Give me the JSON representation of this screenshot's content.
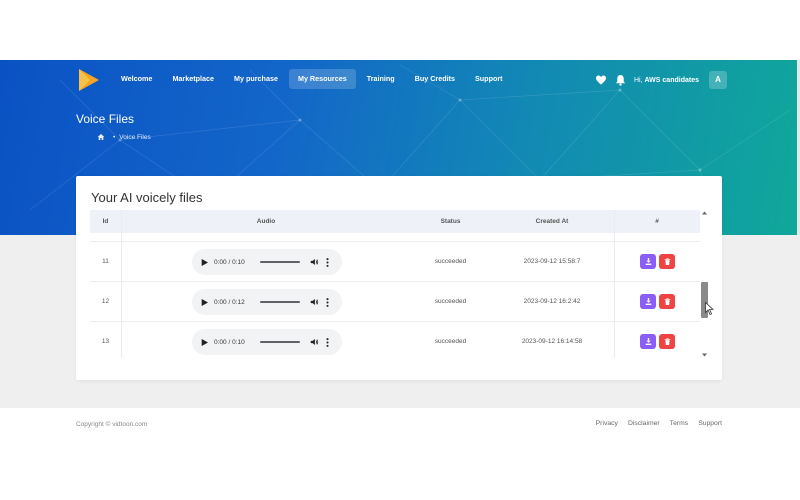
{
  "nav": {
    "items": [
      {
        "label": "Welcome",
        "active": false
      },
      {
        "label": "Marketplace",
        "active": false
      },
      {
        "label": "My purchase",
        "active": false
      },
      {
        "label": "My Resources",
        "active": true
      },
      {
        "label": "Training",
        "active": false
      },
      {
        "label": "Buy Credits",
        "active": false
      },
      {
        "label": "Support",
        "active": false
      }
    ]
  },
  "user": {
    "greeting_prefix": "Hi,",
    "name": "AWS candidates",
    "avatar_letter": "A"
  },
  "page": {
    "title": "Voice Files",
    "breadcrumb_current": "Voice Files"
  },
  "card": {
    "title": "Your AI voicely files",
    "columns": [
      "Id",
      "Audio",
      "Status",
      "Created At",
      "#"
    ],
    "rows": [
      {
        "id": "11",
        "time": "0:00 / 0:10",
        "status": "succeeded",
        "created": "2023-09-12 15:58:7"
      },
      {
        "id": "12",
        "time": "0:00 / 0:12",
        "status": "succeeded",
        "created": "2023-09-12 16:2:42"
      },
      {
        "id": "13",
        "time": "0:00 / 0:10",
        "status": "succeeded",
        "created": "2023-09-12 16:14:58"
      }
    ]
  },
  "footer": {
    "copyright": "Copyright © vidtoon.com",
    "links": [
      "Privacy",
      "Disclaimer",
      "Terms",
      "Support"
    ]
  },
  "colors": {
    "accent_download": "#8b5cf6",
    "accent_delete": "#ef4444",
    "hero_start": "#0a52c4",
    "hero_end": "#10a89a"
  },
  "icons": {
    "logo": "play-logo-icon",
    "heart": "heart-icon",
    "bell": "bell-icon",
    "home": "home-icon",
    "download": "download-icon",
    "delete": "trash-icon"
  }
}
